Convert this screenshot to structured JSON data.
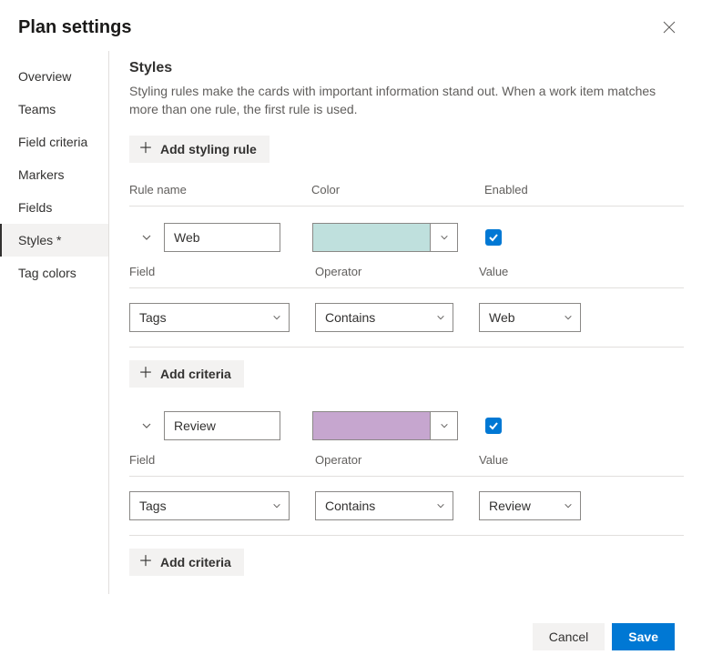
{
  "header": {
    "title": "Plan settings"
  },
  "sidebar": {
    "items": [
      {
        "label": "Overview"
      },
      {
        "label": "Teams"
      },
      {
        "label": "Field criteria"
      },
      {
        "label": "Markers"
      },
      {
        "label": "Fields"
      },
      {
        "label": "Styles *"
      },
      {
        "label": "Tag colors"
      }
    ]
  },
  "styles": {
    "title": "Styles",
    "description": "Styling rules make the cards with important information stand out. When a work item matches more than one rule, the first rule is used.",
    "add_rule_label": "Add styling rule",
    "columns": {
      "name": "Rule name",
      "color": "Color",
      "enabled": "Enabled"
    },
    "criteria_columns": {
      "field": "Field",
      "operator": "Operator",
      "value": "Value"
    },
    "add_criteria_label": "Add criteria",
    "rules": [
      {
        "name": "Web",
        "color": "#bfe0dd",
        "enabled": true,
        "criteria": [
          {
            "field": "Tags",
            "operator": "Contains",
            "value": "Web"
          }
        ]
      },
      {
        "name": "Review",
        "color": "#c6a6cf",
        "enabled": true,
        "criteria": [
          {
            "field": "Tags",
            "operator": "Contains",
            "value": "Review"
          }
        ]
      }
    ]
  },
  "footer": {
    "cancel": "Cancel",
    "save": "Save"
  }
}
